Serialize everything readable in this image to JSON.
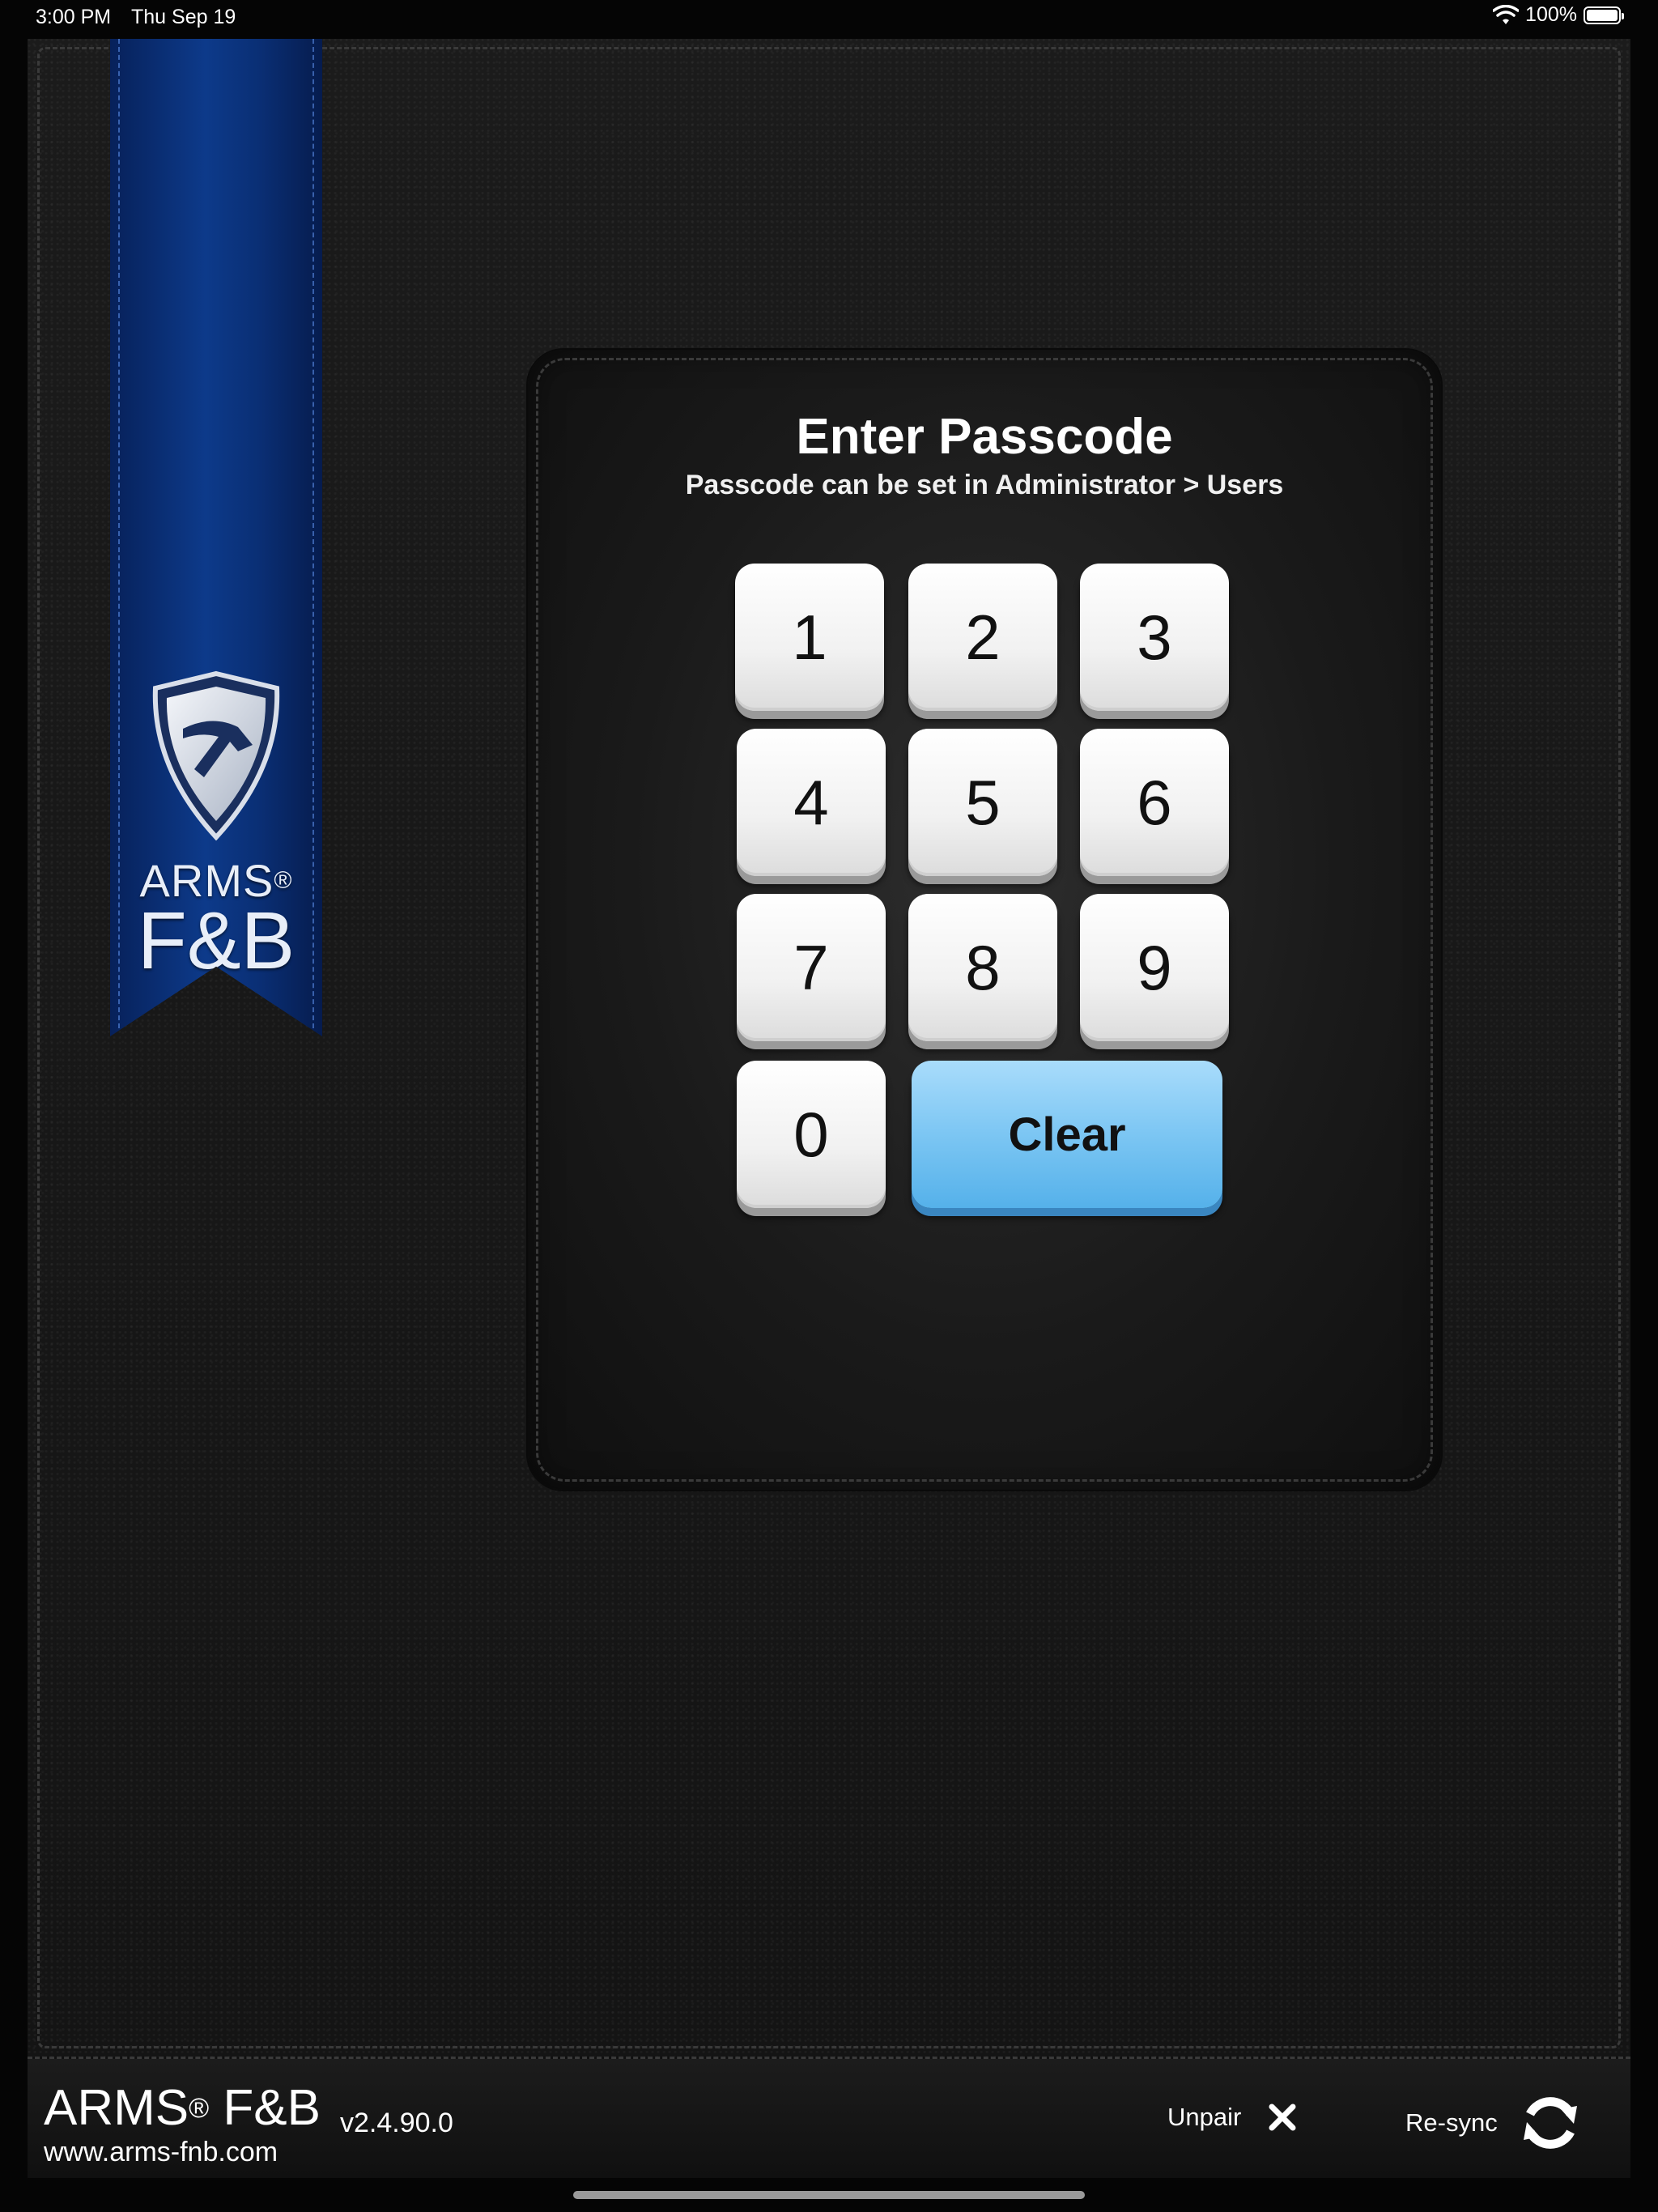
{
  "status_bar": {
    "time": "3:00 PM",
    "date": "Thu Sep 19",
    "battery": "100%"
  },
  "ribbon": {
    "brand_top": "ARMS",
    "brand_reg": "®",
    "brand_bottom": "F&B"
  },
  "passcode": {
    "title": "Enter Passcode",
    "subtitle": "Passcode can be set in Administrator > Users",
    "keys": [
      "1",
      "2",
      "3",
      "4",
      "5",
      "6",
      "7",
      "8",
      "9",
      "0"
    ],
    "clear_label": "Clear"
  },
  "footer": {
    "brand_left": "ARMS",
    "brand_reg": "®",
    "brand_right": " F&B",
    "url": "www.arms-fnb.com",
    "version": "v2.4.90.0",
    "unpair_label": "Unpair",
    "resync_label": "Re-sync"
  },
  "colors": {
    "ribbon_blue": "#0d3a8a",
    "clear_blue": "#7cc6f3",
    "background": "#141414"
  },
  "icons": {
    "wifi": "wifi-icon",
    "battery": "battery-icon",
    "logo": "shield-icon",
    "unpair": "close-icon",
    "resync": "refresh-icon"
  }
}
